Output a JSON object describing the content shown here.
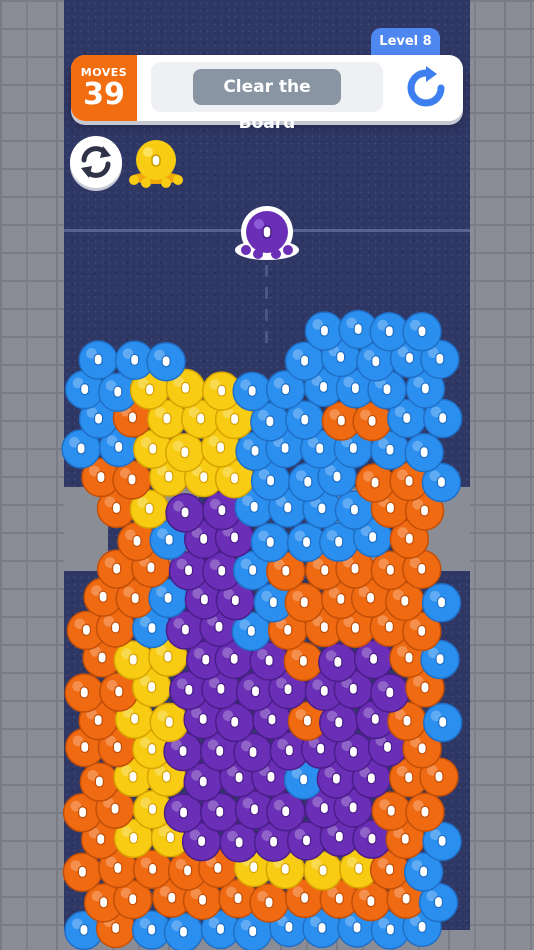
{
  "hud": {
    "moves_label": "MOVES",
    "moves_value": "39",
    "goal_text": "Clear the Board",
    "level_label": "Level 8"
  },
  "icons": {
    "restart": "restart-arrow-icon",
    "swap": "swap-arrows-icon"
  },
  "queue": {
    "next_blob_color": "yellow",
    "current_blob_color": "purple"
  },
  "colors": {
    "blue": "#2b8ff0",
    "orange": "#f06a12",
    "yellow": "#f7cc12",
    "purple": "#6a2fb6",
    "accent_blue": "#4f87f0",
    "moves_orange": "#f26d10"
  }
}
